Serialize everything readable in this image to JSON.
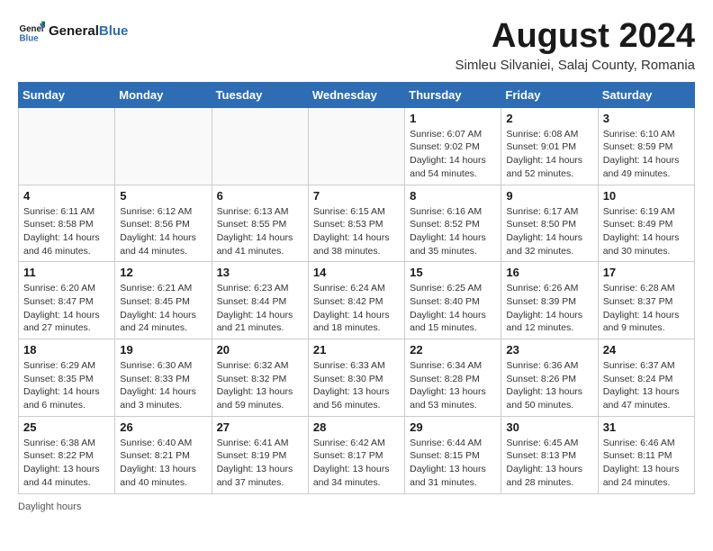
{
  "logo": {
    "text_general": "General",
    "text_blue": "Blue"
  },
  "header": {
    "month_year": "August 2024",
    "location": "Simleu Silvaniei, Salaj County, Romania"
  },
  "days_of_week": [
    "Sunday",
    "Monday",
    "Tuesday",
    "Wednesday",
    "Thursday",
    "Friday",
    "Saturday"
  ],
  "footer": {
    "note": "Daylight hours"
  },
  "weeks": [
    [
      {
        "day": "",
        "info": ""
      },
      {
        "day": "",
        "info": ""
      },
      {
        "day": "",
        "info": ""
      },
      {
        "day": "",
        "info": ""
      },
      {
        "day": "1",
        "info": "Sunrise: 6:07 AM\nSunset: 9:02 PM\nDaylight: 14 hours\nand 54 minutes."
      },
      {
        "day": "2",
        "info": "Sunrise: 6:08 AM\nSunset: 9:01 PM\nDaylight: 14 hours\nand 52 minutes."
      },
      {
        "day": "3",
        "info": "Sunrise: 6:10 AM\nSunset: 8:59 PM\nDaylight: 14 hours\nand 49 minutes."
      }
    ],
    [
      {
        "day": "4",
        "info": "Sunrise: 6:11 AM\nSunset: 8:58 PM\nDaylight: 14 hours\nand 46 minutes."
      },
      {
        "day": "5",
        "info": "Sunrise: 6:12 AM\nSunset: 8:56 PM\nDaylight: 14 hours\nand 44 minutes."
      },
      {
        "day": "6",
        "info": "Sunrise: 6:13 AM\nSunset: 8:55 PM\nDaylight: 14 hours\nand 41 minutes."
      },
      {
        "day": "7",
        "info": "Sunrise: 6:15 AM\nSunset: 8:53 PM\nDaylight: 14 hours\nand 38 minutes."
      },
      {
        "day": "8",
        "info": "Sunrise: 6:16 AM\nSunset: 8:52 PM\nDaylight: 14 hours\nand 35 minutes."
      },
      {
        "day": "9",
        "info": "Sunrise: 6:17 AM\nSunset: 8:50 PM\nDaylight: 14 hours\nand 32 minutes."
      },
      {
        "day": "10",
        "info": "Sunrise: 6:19 AM\nSunset: 8:49 PM\nDaylight: 14 hours\nand 30 minutes."
      }
    ],
    [
      {
        "day": "11",
        "info": "Sunrise: 6:20 AM\nSunset: 8:47 PM\nDaylight: 14 hours\nand 27 minutes."
      },
      {
        "day": "12",
        "info": "Sunrise: 6:21 AM\nSunset: 8:45 PM\nDaylight: 14 hours\nand 24 minutes."
      },
      {
        "day": "13",
        "info": "Sunrise: 6:23 AM\nSunset: 8:44 PM\nDaylight: 14 hours\nand 21 minutes."
      },
      {
        "day": "14",
        "info": "Sunrise: 6:24 AM\nSunset: 8:42 PM\nDaylight: 14 hours\nand 18 minutes."
      },
      {
        "day": "15",
        "info": "Sunrise: 6:25 AM\nSunset: 8:40 PM\nDaylight: 14 hours\nand 15 minutes."
      },
      {
        "day": "16",
        "info": "Sunrise: 6:26 AM\nSunset: 8:39 PM\nDaylight: 14 hours\nand 12 minutes."
      },
      {
        "day": "17",
        "info": "Sunrise: 6:28 AM\nSunset: 8:37 PM\nDaylight: 14 hours\nand 9 minutes."
      }
    ],
    [
      {
        "day": "18",
        "info": "Sunrise: 6:29 AM\nSunset: 8:35 PM\nDaylight: 14 hours\nand 6 minutes."
      },
      {
        "day": "19",
        "info": "Sunrise: 6:30 AM\nSunset: 8:33 PM\nDaylight: 14 hours\nand 3 minutes."
      },
      {
        "day": "20",
        "info": "Sunrise: 6:32 AM\nSunset: 8:32 PM\nDaylight: 13 hours\nand 59 minutes."
      },
      {
        "day": "21",
        "info": "Sunrise: 6:33 AM\nSunset: 8:30 PM\nDaylight: 13 hours\nand 56 minutes."
      },
      {
        "day": "22",
        "info": "Sunrise: 6:34 AM\nSunset: 8:28 PM\nDaylight: 13 hours\nand 53 minutes."
      },
      {
        "day": "23",
        "info": "Sunrise: 6:36 AM\nSunset: 8:26 PM\nDaylight: 13 hours\nand 50 minutes."
      },
      {
        "day": "24",
        "info": "Sunrise: 6:37 AM\nSunset: 8:24 PM\nDaylight: 13 hours\nand 47 minutes."
      }
    ],
    [
      {
        "day": "25",
        "info": "Sunrise: 6:38 AM\nSunset: 8:22 PM\nDaylight: 13 hours\nand 44 minutes."
      },
      {
        "day": "26",
        "info": "Sunrise: 6:40 AM\nSunset: 8:21 PM\nDaylight: 13 hours\nand 40 minutes."
      },
      {
        "day": "27",
        "info": "Sunrise: 6:41 AM\nSunset: 8:19 PM\nDaylight: 13 hours\nand 37 minutes."
      },
      {
        "day": "28",
        "info": "Sunrise: 6:42 AM\nSunset: 8:17 PM\nDaylight: 13 hours\nand 34 minutes."
      },
      {
        "day": "29",
        "info": "Sunrise: 6:44 AM\nSunset: 8:15 PM\nDaylight: 13 hours\nand 31 minutes."
      },
      {
        "day": "30",
        "info": "Sunrise: 6:45 AM\nSunset: 8:13 PM\nDaylight: 13 hours\nand 28 minutes."
      },
      {
        "day": "31",
        "info": "Sunrise: 6:46 AM\nSunset: 8:11 PM\nDaylight: 13 hours\nand 24 minutes."
      }
    ]
  ]
}
